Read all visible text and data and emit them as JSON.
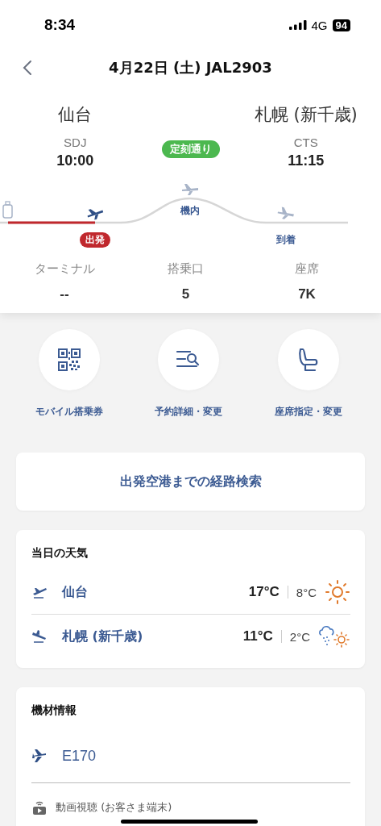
{
  "status_bar": {
    "time": "8:34",
    "network": "4G",
    "battery": "94"
  },
  "header": {
    "title": "4月22日 (土) JAL2903"
  },
  "flight": {
    "departure": {
      "city": "仙台",
      "code": "SDJ",
      "time": "10:00"
    },
    "arrival": {
      "city": "札幌 (新千歳)",
      "code": "CTS",
      "time": "11:15"
    },
    "status": "定刻通り",
    "stages": [
      {
        "kind": "departure",
        "label": "出発",
        "selected": true
      },
      {
        "kind": "inflight",
        "label": "機内",
        "selected": false
      },
      {
        "kind": "arrival",
        "label": "到着",
        "selected": false
      }
    ],
    "details": [
      {
        "label": "ターミナル",
        "value": "--"
      },
      {
        "label": "搭乗口",
        "value": "5"
      },
      {
        "label": "座席",
        "value": "7K"
      }
    ]
  },
  "actions": [
    {
      "kind": "qr",
      "label": "モバイル搭乗券"
    },
    {
      "kind": "search",
      "label": "予約詳細・変更"
    },
    {
      "kind": "seat",
      "label": "座席指定・変更"
    }
  ],
  "route_button": "出発空港までの経路検索",
  "weather": {
    "title": "当日の天気",
    "rows": [
      {
        "kind": "departure",
        "city": "仙台",
        "high": "17°C",
        "low": "8°C",
        "forecast": {
          "kind": "sunny"
        }
      },
      {
        "kind": "arrival",
        "city": "札幌 (新千歳)",
        "high": "11°C",
        "low": "2°C",
        "forecast": {
          "kind": "rain-sun"
        }
      }
    ]
  },
  "equipment": {
    "title": "機材情報",
    "aircraft": "E170",
    "services": [
      {
        "kind": "video",
        "label": "動画視聴 (お客さま端末)"
      }
    ]
  }
}
